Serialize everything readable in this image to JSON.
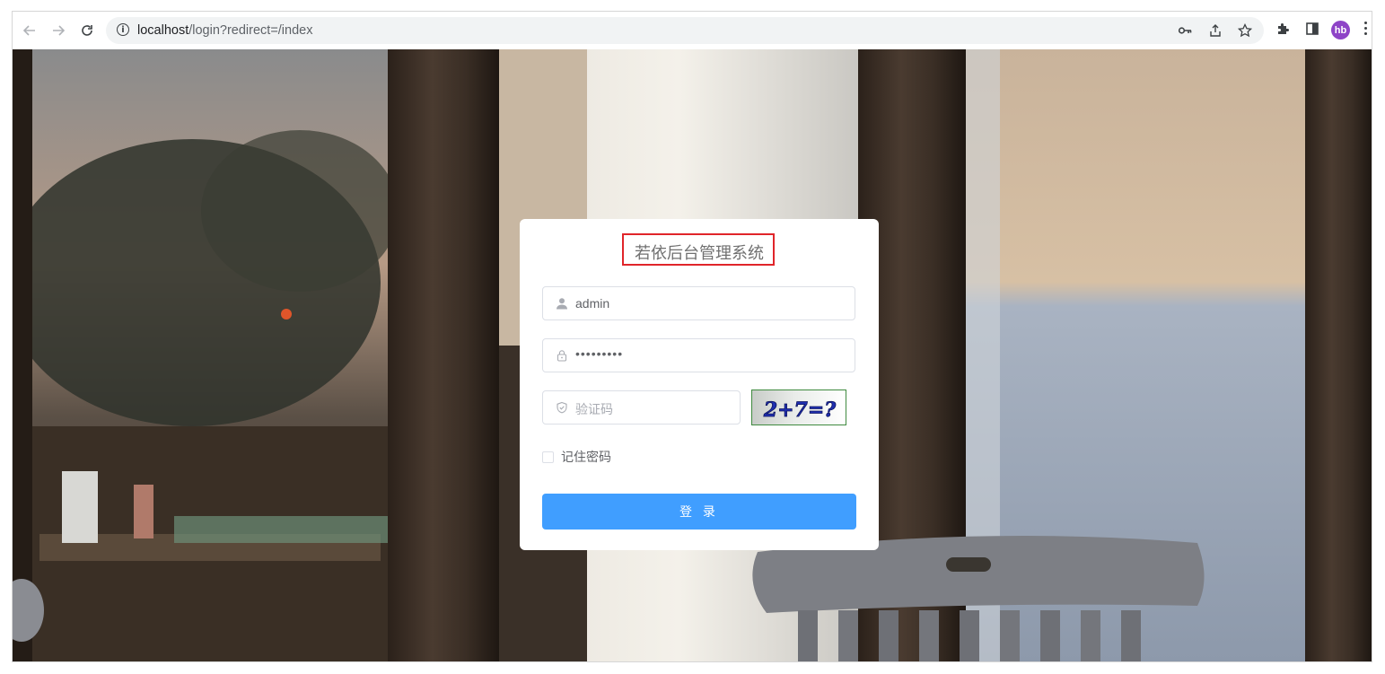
{
  "browser": {
    "url_host": "localhost",
    "url_path": "/login?redirect=/index",
    "profile_initials": "hb",
    "icons": [
      "back-icon",
      "forward-icon",
      "reload-icon",
      "site-info-icon",
      "password-key-icon",
      "share-icon",
      "bookmark-star-icon",
      "extensions-icon",
      "side-panel-icon",
      "more-menu-icon"
    ]
  },
  "login": {
    "title": "若依后台管理系统",
    "username_value": "admin",
    "password_value": "•••••••••",
    "code_placeholder": "验证码",
    "captcha_text": "2+7=?",
    "remember_label": "记住密码",
    "submit_label": "登 录"
  },
  "colors": {
    "accent": "#409eff",
    "highlight_box": "#e0252a",
    "profile": "#8e44c7"
  }
}
